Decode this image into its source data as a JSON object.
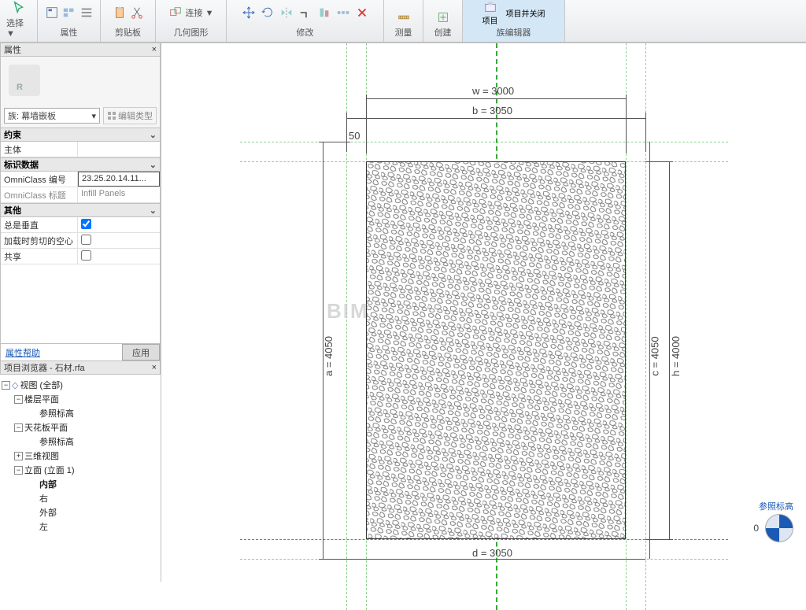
{
  "ribbon": {
    "select": "选择 ▼",
    "properties": "属性",
    "clipboard": "剪贴板",
    "geometry": "几何图形",
    "modify": "修改",
    "measure": "测量",
    "create": "创建",
    "famEditor": "族编辑器",
    "project": "项目",
    "projectClose": "项目并关闭"
  },
  "propsPanel": {
    "title": "属性",
    "typeLabel": "族: 幕墙嵌板",
    "editType": "编辑类型",
    "sec_constraint": "约束",
    "host": "主体",
    "sec_id": "标识数据",
    "omniNum_k": "OmniClass 编号",
    "omniNum_v": "23.25.20.14.11...",
    "omniTitle_k": "OmniClass 标题",
    "omniTitle_v": "Infill Panels",
    "sec_other": "其他",
    "alwaysVert": "总是垂直",
    "voidWhenCut": "加载时剪切的空心",
    "shared": "共享",
    "helpLink": "属性帮助",
    "apply": "应用"
  },
  "browser": {
    "title": "项目浏览器 - 石材.rfa",
    "viewsAll": "视图 (全部)",
    "floorPlan": "楼层平面",
    "refLevel": "参照标高",
    "ceilingPlan": "天花板平面",
    "threeD": "三维视图",
    "elevations": "立面 (立面 1)",
    "interior": "内部",
    "right": "右",
    "exterior": "外部",
    "left": "左"
  },
  "drawing": {
    "w": "w = 3000",
    "b": "b = 3050",
    "fifty": "50",
    "a": "a = 4050",
    "c": "c = 4050",
    "h": "h = 4000",
    "d": "d = 3050"
  },
  "view": {
    "reference": "参照标高",
    "zero": "0"
  },
  "watermark": "BIM"
}
